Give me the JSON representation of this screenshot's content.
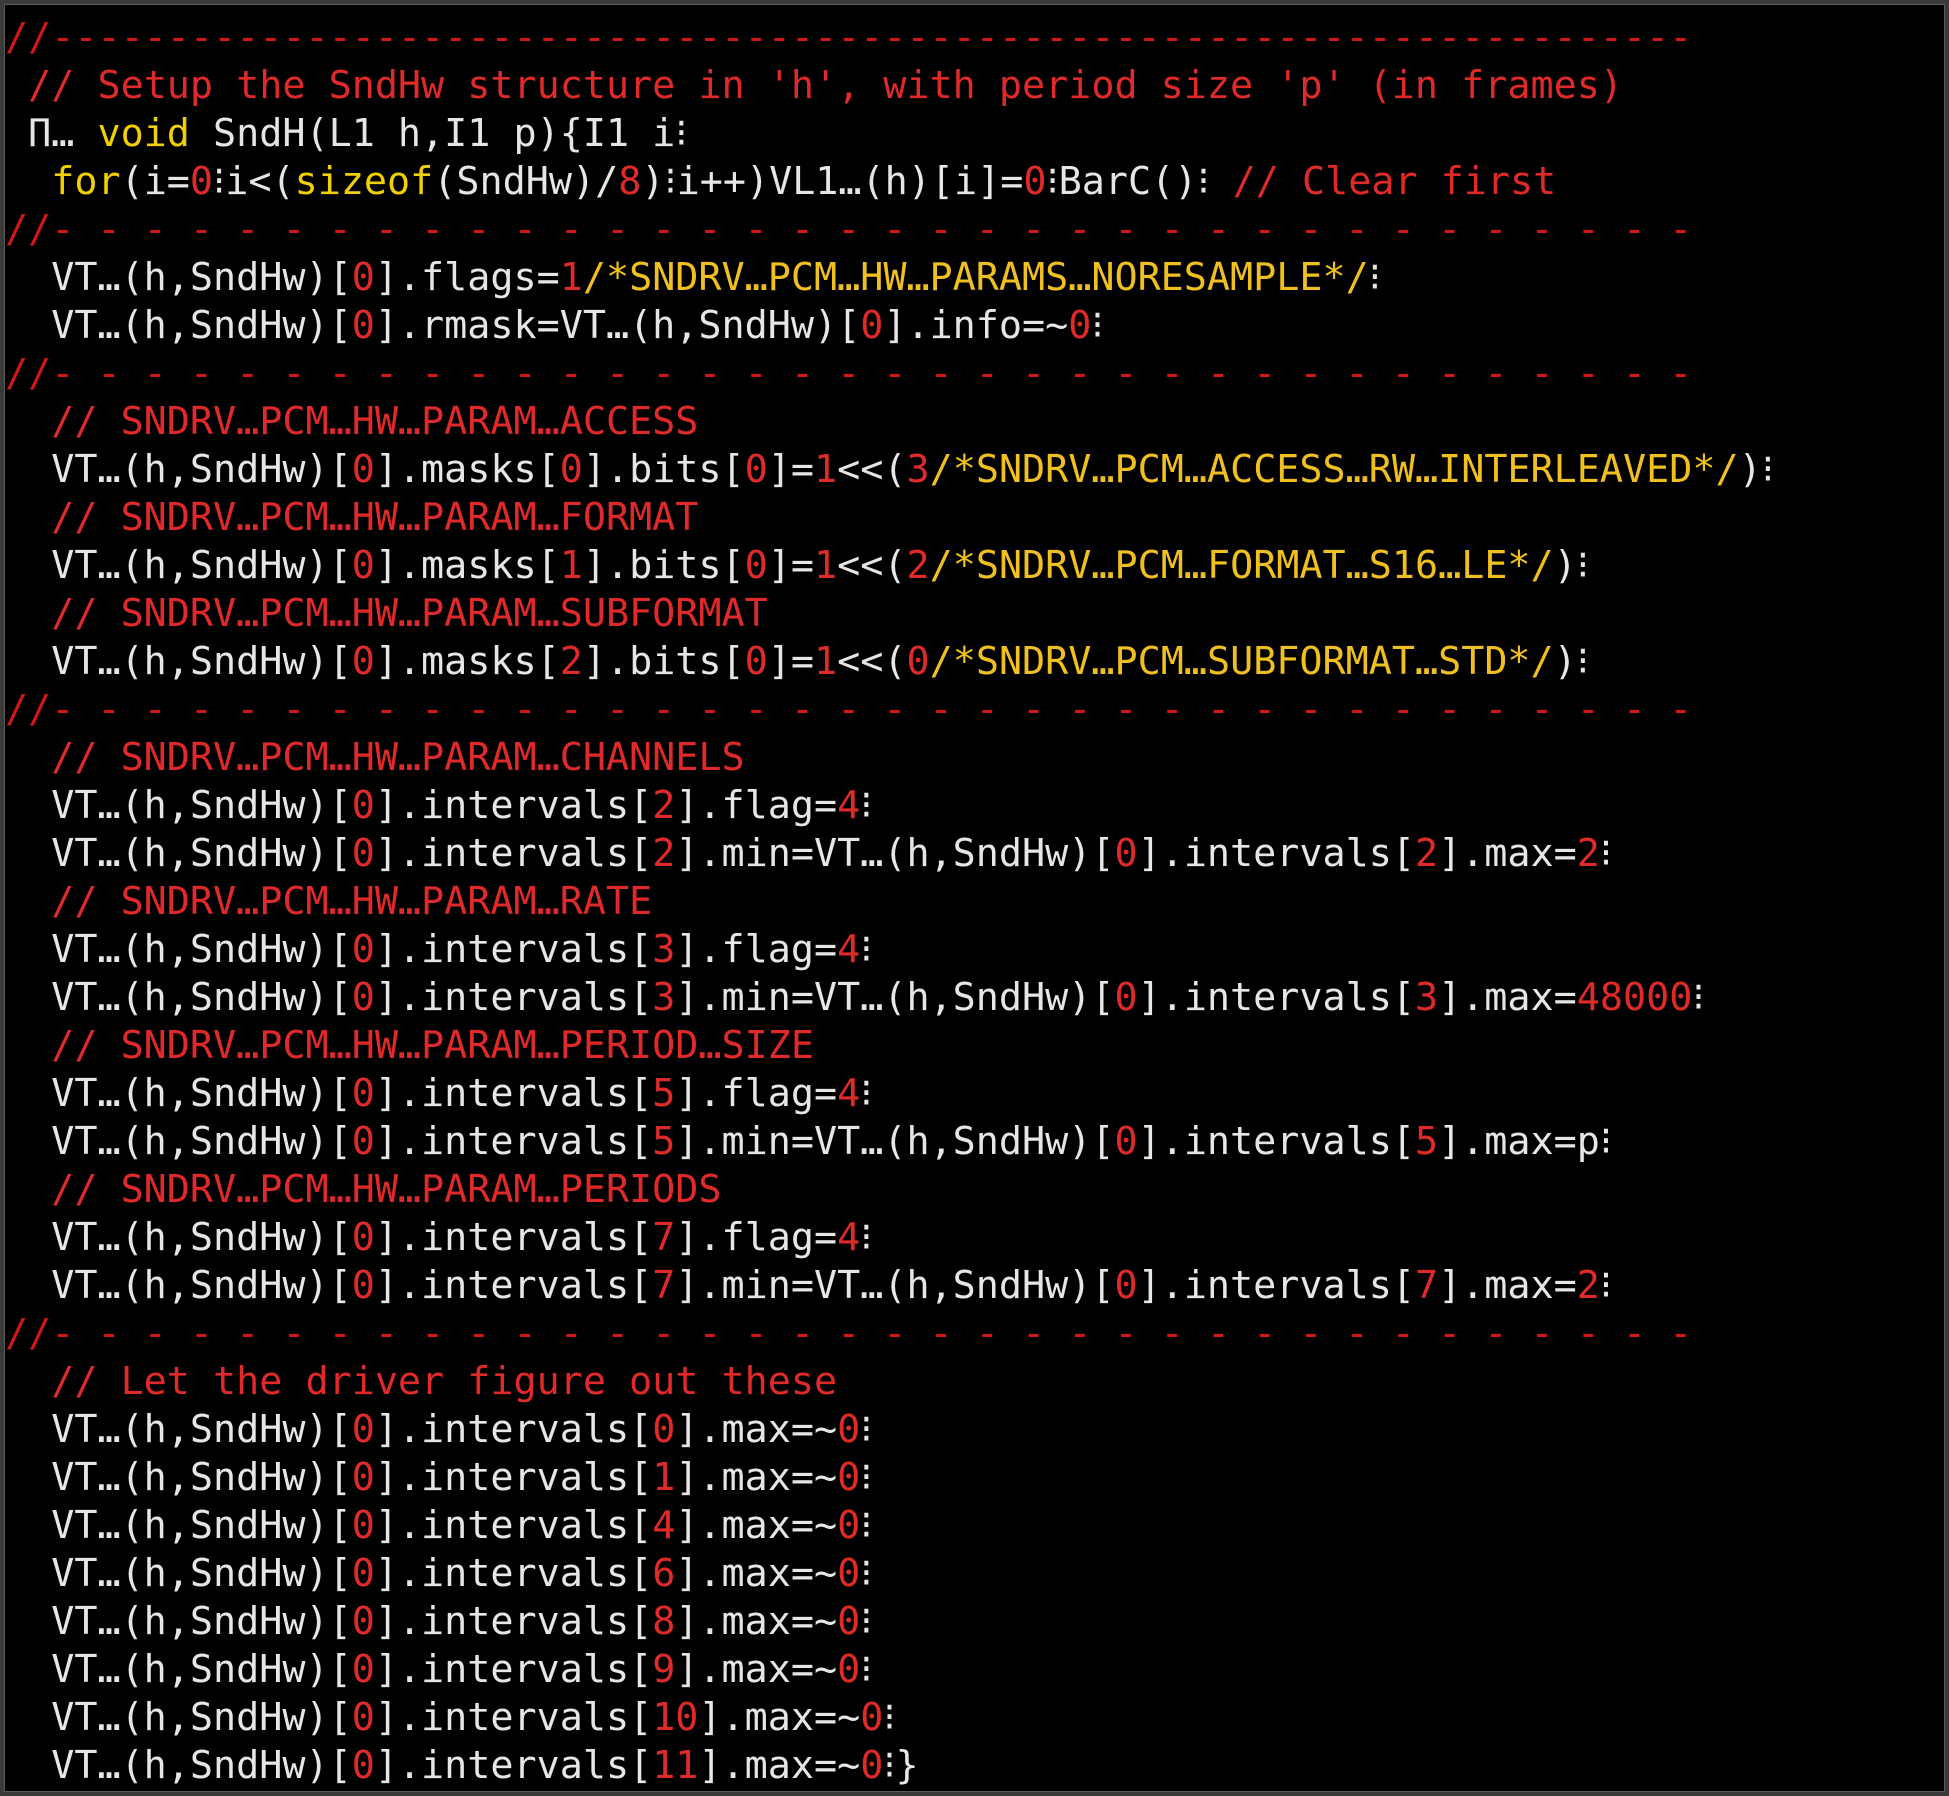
{
  "theme": {
    "background": "#000000",
    "plain": "#e6e6e6",
    "comment": "#e02a2a",
    "number": "#e02a2a",
    "keyword": "#f0d000",
    "constant": "#f0c020",
    "divider": "#d01818"
  },
  "lines": [
    [
      {
        "t": "div",
        "s": "//-----------------------------------------------------------------------"
      }
    ],
    [
      {
        "t": "plain",
        "s": " "
      },
      {
        "t": "comment",
        "s": "// Setup the SndHw structure in 'h', with period size 'p' (in frames)"
      }
    ],
    [
      {
        "t": "plain",
        "s": " Π… "
      },
      {
        "t": "keyword",
        "s": "void"
      },
      {
        "t": "plain",
        "s": " SndH(L1 h,I1 p){I1 i⁝"
      }
    ],
    [
      {
        "t": "plain",
        "s": "  "
      },
      {
        "t": "keyword",
        "s": "for"
      },
      {
        "t": "plain",
        "s": "(i="
      },
      {
        "t": "number",
        "s": "0"
      },
      {
        "t": "plain",
        "s": "⁝i<("
      },
      {
        "t": "keyword",
        "s": "sizeof"
      },
      {
        "t": "plain",
        "s": "(SndHw)/"
      },
      {
        "t": "number",
        "s": "8"
      },
      {
        "t": "plain",
        "s": ")⁝i++)VL1…(h)[i]="
      },
      {
        "t": "number",
        "s": "0"
      },
      {
        "t": "plain",
        "s": "⁝BarC()⁝ "
      },
      {
        "t": "comment",
        "s": "// Clear first"
      }
    ],
    [
      {
        "t": "div",
        "s": "//- - - - - - - - - - - - - - - - - - - - - - - - - - - - - - - - - - - -"
      }
    ],
    [
      {
        "t": "plain",
        "s": "  VT…(h,SndHw)["
      },
      {
        "t": "number",
        "s": "0"
      },
      {
        "t": "plain",
        "s": "].flags="
      },
      {
        "t": "number",
        "s": "1"
      },
      {
        "t": "hex",
        "s": "/*SNDRV…PCM…HW…PARAMS…NORESAMPLE*/"
      },
      {
        "t": "plain",
        "s": "⁝"
      }
    ],
    [
      {
        "t": "plain",
        "s": "  VT…(h,SndHw)["
      },
      {
        "t": "number",
        "s": "0"
      },
      {
        "t": "plain",
        "s": "].rmask=VT…(h,SndHw)["
      },
      {
        "t": "number",
        "s": "0"
      },
      {
        "t": "plain",
        "s": "].info=~"
      },
      {
        "t": "number",
        "s": "0"
      },
      {
        "t": "plain",
        "s": "⁝"
      }
    ],
    [
      {
        "t": "div",
        "s": "//- - - - - - - - - - - - - - - - - - - - - - - - - - - - - - - - - - - -"
      }
    ],
    [
      {
        "t": "plain",
        "s": "  "
      },
      {
        "t": "comment",
        "s": "// SNDRV…PCM…HW…PARAM…ACCESS"
      }
    ],
    [
      {
        "t": "plain",
        "s": "  VT…(h,SndHw)["
      },
      {
        "t": "number",
        "s": "0"
      },
      {
        "t": "plain",
        "s": "].masks["
      },
      {
        "t": "number",
        "s": "0"
      },
      {
        "t": "plain",
        "s": "].bits["
      },
      {
        "t": "number",
        "s": "0"
      },
      {
        "t": "plain",
        "s": "]="
      },
      {
        "t": "number",
        "s": "1"
      },
      {
        "t": "plain",
        "s": "<<("
      },
      {
        "t": "number",
        "s": "3"
      },
      {
        "t": "hex",
        "s": "/*SNDRV…PCM…ACCESS…RW…INTERLEAVED*/"
      },
      {
        "t": "plain",
        "s": ")⁝"
      }
    ],
    [
      {
        "t": "plain",
        "s": "  "
      },
      {
        "t": "comment",
        "s": "// SNDRV…PCM…HW…PARAM…FORMAT"
      }
    ],
    [
      {
        "t": "plain",
        "s": "  VT…(h,SndHw)["
      },
      {
        "t": "number",
        "s": "0"
      },
      {
        "t": "plain",
        "s": "].masks["
      },
      {
        "t": "number",
        "s": "1"
      },
      {
        "t": "plain",
        "s": "].bits["
      },
      {
        "t": "number",
        "s": "0"
      },
      {
        "t": "plain",
        "s": "]="
      },
      {
        "t": "number",
        "s": "1"
      },
      {
        "t": "plain",
        "s": "<<("
      },
      {
        "t": "number",
        "s": "2"
      },
      {
        "t": "hex",
        "s": "/*SNDRV…PCM…FORMAT…S16…LE*/"
      },
      {
        "t": "plain",
        "s": ")⁝"
      }
    ],
    [
      {
        "t": "plain",
        "s": "  "
      },
      {
        "t": "comment",
        "s": "// SNDRV…PCM…HW…PARAM…SUBFORMAT"
      }
    ],
    [
      {
        "t": "plain",
        "s": "  VT…(h,SndHw)["
      },
      {
        "t": "number",
        "s": "0"
      },
      {
        "t": "plain",
        "s": "].masks["
      },
      {
        "t": "number",
        "s": "2"
      },
      {
        "t": "plain",
        "s": "].bits["
      },
      {
        "t": "number",
        "s": "0"
      },
      {
        "t": "plain",
        "s": "]="
      },
      {
        "t": "number",
        "s": "1"
      },
      {
        "t": "plain",
        "s": "<<("
      },
      {
        "t": "number",
        "s": "0"
      },
      {
        "t": "hex",
        "s": "/*SNDRV…PCM…SUBFORMAT…STD*/"
      },
      {
        "t": "plain",
        "s": ")⁝"
      }
    ],
    [
      {
        "t": "div",
        "s": "//- - - - - - - - - - - - - - - - - - - - - - - - - - - - - - - - - - - -"
      }
    ],
    [
      {
        "t": "plain",
        "s": "  "
      },
      {
        "t": "comment",
        "s": "// SNDRV…PCM…HW…PARAM…CHANNELS"
      }
    ],
    [
      {
        "t": "plain",
        "s": "  VT…(h,SndHw)["
      },
      {
        "t": "number",
        "s": "0"
      },
      {
        "t": "plain",
        "s": "].intervals["
      },
      {
        "t": "number",
        "s": "2"
      },
      {
        "t": "plain",
        "s": "].flag="
      },
      {
        "t": "number",
        "s": "4"
      },
      {
        "t": "plain",
        "s": "⁝"
      }
    ],
    [
      {
        "t": "plain",
        "s": "  VT…(h,SndHw)["
      },
      {
        "t": "number",
        "s": "0"
      },
      {
        "t": "plain",
        "s": "].intervals["
      },
      {
        "t": "number",
        "s": "2"
      },
      {
        "t": "plain",
        "s": "].min=VT…(h,SndHw)["
      },
      {
        "t": "number",
        "s": "0"
      },
      {
        "t": "plain",
        "s": "].intervals["
      },
      {
        "t": "number",
        "s": "2"
      },
      {
        "t": "plain",
        "s": "].max="
      },
      {
        "t": "number",
        "s": "2"
      },
      {
        "t": "plain",
        "s": "⁝"
      }
    ],
    [
      {
        "t": "plain",
        "s": "  "
      },
      {
        "t": "comment",
        "s": "// SNDRV…PCM…HW…PARAM…RATE"
      }
    ],
    [
      {
        "t": "plain",
        "s": "  VT…(h,SndHw)["
      },
      {
        "t": "number",
        "s": "0"
      },
      {
        "t": "plain",
        "s": "].intervals["
      },
      {
        "t": "number",
        "s": "3"
      },
      {
        "t": "plain",
        "s": "].flag="
      },
      {
        "t": "number",
        "s": "4"
      },
      {
        "t": "plain",
        "s": "⁝"
      }
    ],
    [
      {
        "t": "plain",
        "s": "  VT…(h,SndHw)["
      },
      {
        "t": "number",
        "s": "0"
      },
      {
        "t": "plain",
        "s": "].intervals["
      },
      {
        "t": "number",
        "s": "3"
      },
      {
        "t": "plain",
        "s": "].min=VT…(h,SndHw)["
      },
      {
        "t": "number",
        "s": "0"
      },
      {
        "t": "plain",
        "s": "].intervals["
      },
      {
        "t": "number",
        "s": "3"
      },
      {
        "t": "plain",
        "s": "].max="
      },
      {
        "t": "number",
        "s": "48000"
      },
      {
        "t": "plain",
        "s": "⁝"
      }
    ],
    [
      {
        "t": "plain",
        "s": "  "
      },
      {
        "t": "comment",
        "s": "// SNDRV…PCM…HW…PARAM…PERIOD…SIZE"
      }
    ],
    [
      {
        "t": "plain",
        "s": "  VT…(h,SndHw)["
      },
      {
        "t": "number",
        "s": "0"
      },
      {
        "t": "plain",
        "s": "].intervals["
      },
      {
        "t": "number",
        "s": "5"
      },
      {
        "t": "plain",
        "s": "].flag="
      },
      {
        "t": "number",
        "s": "4"
      },
      {
        "t": "plain",
        "s": "⁝"
      }
    ],
    [
      {
        "t": "plain",
        "s": "  VT…(h,SndHw)["
      },
      {
        "t": "number",
        "s": "0"
      },
      {
        "t": "plain",
        "s": "].intervals["
      },
      {
        "t": "number",
        "s": "5"
      },
      {
        "t": "plain",
        "s": "].min=VT…(h,SndHw)["
      },
      {
        "t": "number",
        "s": "0"
      },
      {
        "t": "plain",
        "s": "].intervals["
      },
      {
        "t": "number",
        "s": "5"
      },
      {
        "t": "plain",
        "s": "].max=p⁝"
      }
    ],
    [
      {
        "t": "plain",
        "s": "  "
      },
      {
        "t": "comment",
        "s": "// SNDRV…PCM…HW…PARAM…PERIODS"
      }
    ],
    [
      {
        "t": "plain",
        "s": "  VT…(h,SndHw)["
      },
      {
        "t": "number",
        "s": "0"
      },
      {
        "t": "plain",
        "s": "].intervals["
      },
      {
        "t": "number",
        "s": "7"
      },
      {
        "t": "plain",
        "s": "].flag="
      },
      {
        "t": "number",
        "s": "4"
      },
      {
        "t": "plain",
        "s": "⁝"
      }
    ],
    [
      {
        "t": "plain",
        "s": "  VT…(h,SndHw)["
      },
      {
        "t": "number",
        "s": "0"
      },
      {
        "t": "plain",
        "s": "].intervals["
      },
      {
        "t": "number",
        "s": "7"
      },
      {
        "t": "plain",
        "s": "].min=VT…(h,SndHw)["
      },
      {
        "t": "number",
        "s": "0"
      },
      {
        "t": "plain",
        "s": "].intervals["
      },
      {
        "t": "number",
        "s": "7"
      },
      {
        "t": "plain",
        "s": "].max="
      },
      {
        "t": "number",
        "s": "2"
      },
      {
        "t": "plain",
        "s": "⁝"
      }
    ],
    [
      {
        "t": "div",
        "s": "//- - - - - - - - - - - - - - - - - - - - - - - - - - - - - - - - - - - -"
      }
    ],
    [
      {
        "t": "plain",
        "s": "  "
      },
      {
        "t": "comment",
        "s": "// Let the driver figure out these"
      }
    ],
    [
      {
        "t": "plain",
        "s": "  VT…(h,SndHw)["
      },
      {
        "t": "number",
        "s": "0"
      },
      {
        "t": "plain",
        "s": "].intervals["
      },
      {
        "t": "number",
        "s": "0"
      },
      {
        "t": "plain",
        "s": "].max=~"
      },
      {
        "t": "number",
        "s": "0"
      },
      {
        "t": "plain",
        "s": "⁝"
      }
    ],
    [
      {
        "t": "plain",
        "s": "  VT…(h,SndHw)["
      },
      {
        "t": "number",
        "s": "0"
      },
      {
        "t": "plain",
        "s": "].intervals["
      },
      {
        "t": "number",
        "s": "1"
      },
      {
        "t": "plain",
        "s": "].max=~"
      },
      {
        "t": "number",
        "s": "0"
      },
      {
        "t": "plain",
        "s": "⁝"
      }
    ],
    [
      {
        "t": "plain",
        "s": "  VT…(h,SndHw)["
      },
      {
        "t": "number",
        "s": "0"
      },
      {
        "t": "plain",
        "s": "].intervals["
      },
      {
        "t": "number",
        "s": "4"
      },
      {
        "t": "plain",
        "s": "].max=~"
      },
      {
        "t": "number",
        "s": "0"
      },
      {
        "t": "plain",
        "s": "⁝"
      }
    ],
    [
      {
        "t": "plain",
        "s": "  VT…(h,SndHw)["
      },
      {
        "t": "number",
        "s": "0"
      },
      {
        "t": "plain",
        "s": "].intervals["
      },
      {
        "t": "number",
        "s": "6"
      },
      {
        "t": "plain",
        "s": "].max=~"
      },
      {
        "t": "number",
        "s": "0"
      },
      {
        "t": "plain",
        "s": "⁝"
      }
    ],
    [
      {
        "t": "plain",
        "s": "  VT…(h,SndHw)["
      },
      {
        "t": "number",
        "s": "0"
      },
      {
        "t": "plain",
        "s": "].intervals["
      },
      {
        "t": "number",
        "s": "8"
      },
      {
        "t": "plain",
        "s": "].max=~"
      },
      {
        "t": "number",
        "s": "0"
      },
      {
        "t": "plain",
        "s": "⁝"
      }
    ],
    [
      {
        "t": "plain",
        "s": "  VT…(h,SndHw)["
      },
      {
        "t": "number",
        "s": "0"
      },
      {
        "t": "plain",
        "s": "].intervals["
      },
      {
        "t": "number",
        "s": "9"
      },
      {
        "t": "plain",
        "s": "].max=~"
      },
      {
        "t": "number",
        "s": "0"
      },
      {
        "t": "plain",
        "s": "⁝"
      }
    ],
    [
      {
        "t": "plain",
        "s": "  VT…(h,SndHw)["
      },
      {
        "t": "number",
        "s": "0"
      },
      {
        "t": "plain",
        "s": "].intervals["
      },
      {
        "t": "number",
        "s": "10"
      },
      {
        "t": "plain",
        "s": "].max=~"
      },
      {
        "t": "number",
        "s": "0"
      },
      {
        "t": "plain",
        "s": "⁝"
      }
    ],
    [
      {
        "t": "plain",
        "s": "  VT…(h,SndHw)["
      },
      {
        "t": "number",
        "s": "0"
      },
      {
        "t": "plain",
        "s": "].intervals["
      },
      {
        "t": "number",
        "s": "11"
      },
      {
        "t": "plain",
        "s": "].max=~"
      },
      {
        "t": "number",
        "s": "0"
      },
      {
        "t": "plain",
        "s": "⁝}"
      }
    ]
  ]
}
